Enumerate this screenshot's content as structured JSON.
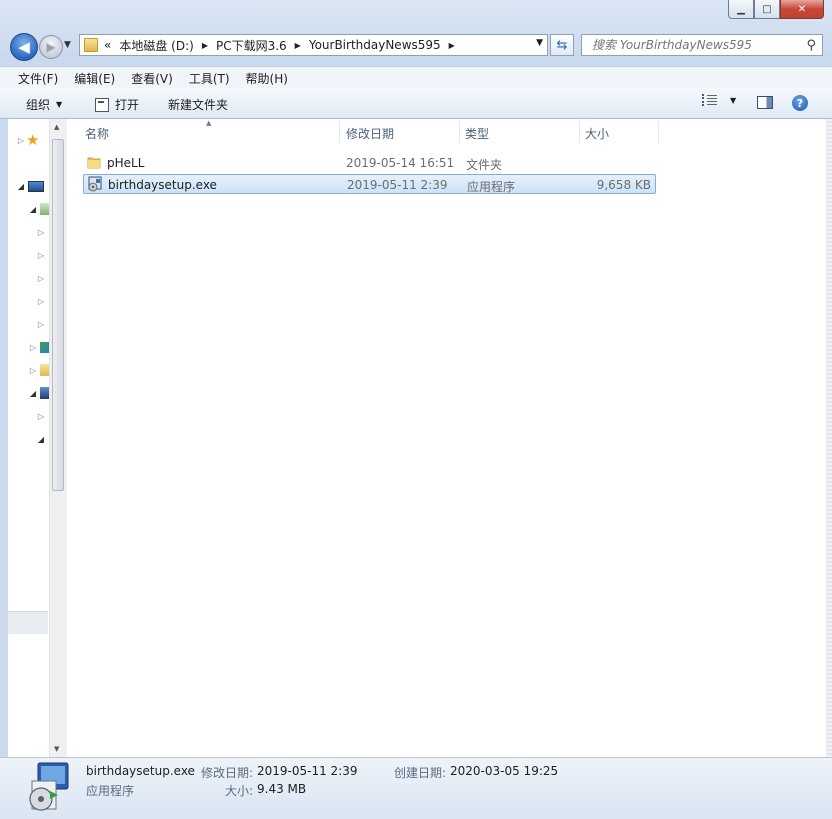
{
  "window": {
    "caption": {
      "minimize_glyph": "▁",
      "maximize_glyph": "□",
      "close_glyph": "✕"
    }
  },
  "nav": {
    "back_glyph": "◀",
    "forward_glyph": "▶",
    "address": {
      "overflow": "«",
      "crumbs": [
        "本地磁盘 (D:)",
        "PC下载网3.6",
        "YourBirthdayNews595"
      ]
    },
    "search_placeholder": "搜索 YourBirthdayNews595"
  },
  "menu": [
    "文件(F)",
    "编辑(E)",
    "查看(V)",
    "工具(T)",
    "帮助(H)"
  ],
  "commands": {
    "organize": "组织",
    "open": "打开",
    "new_folder": "新建文件夹"
  },
  "columns": {
    "name": "名称",
    "date": "修改日期",
    "type": "类型",
    "size": "大小"
  },
  "files": [
    {
      "name": "pHeLL",
      "date": "2019-05-14 16:51",
      "type": "文件夹",
      "size": "",
      "icon": "folder-icon",
      "selected": false
    },
    {
      "name": "birthdaysetup.exe",
      "date": "2019-05-11 2:39",
      "type": "应用程序",
      "size": "9,658 KB",
      "icon": "installer-icon",
      "selected": true
    }
  ],
  "details": {
    "filename": "birthdaysetup.exe",
    "kind": "应用程序",
    "modified_label": "修改日期:",
    "modified_value": "2019-05-11 2:39",
    "created_label": "创建日期:",
    "created_value": "2020-03-05 19:25",
    "size_label": "大小:",
    "size_value": "9.43 MB"
  },
  "colors": {
    "accent": "#2a68c0",
    "selection": "#cde2f8",
    "close": "#c8473a"
  }
}
